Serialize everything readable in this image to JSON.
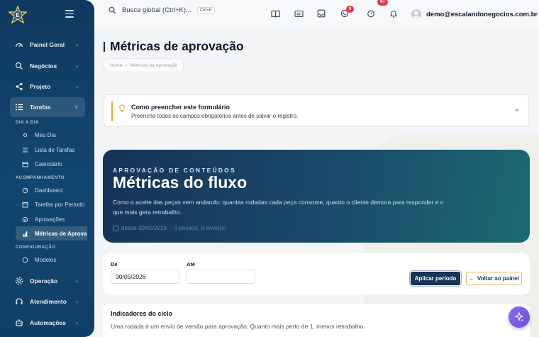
{
  "sidebar": {
    "logo_letter": "E",
    "nav": [
      {
        "label": "Painel Geral",
        "icon": "dashboard-gauge-icon"
      },
      {
        "label": "Negócios",
        "icon": "search-icon"
      },
      {
        "label": "Projeto",
        "icon": "share-nodes-icon"
      },
      {
        "label": "Tarefas",
        "icon": "tasks-list-icon"
      },
      {
        "label": "Operação",
        "icon": "gear-icon"
      },
      {
        "label": "Atendimento",
        "icon": "headset-icon"
      },
      {
        "label": "Automações",
        "icon": "robot-icon"
      }
    ],
    "sections": {
      "dia_a_dia": "DIA A DIA",
      "acompanhamento": "ACOMPANHAMENTO",
      "configuracao": "CONFIGURAÇÃO"
    },
    "sub_items": {
      "meu_dia": "Meu Dia",
      "lista_tarefas": "Lista de Tarefas",
      "calendario": "Calendário",
      "dashboard": "Dashboard",
      "tarefas_periodo": "Tarefas por Período",
      "aprovacoes": "Aprovações",
      "metricas": "Métricas de Aprova",
      "modelos": "Modelos"
    }
  },
  "topbar": {
    "search_placeholder": "Busca global (Ctrl+K)...",
    "shortcut": "Ctrl+K",
    "whatsapp_badge": "0",
    "timer_badge": "9+",
    "user_email": "demo@escalandonegocios.com.br"
  },
  "page": {
    "title": "Métricas de aprovação",
    "breadcrumb": [
      "Home",
      "Métricas de Aprovação"
    ]
  },
  "info_card": {
    "title": "Como preencher este formulário",
    "text": "Preencha todos os campos obrigatórios antes de salvar o registro."
  },
  "hero": {
    "eyebrow": "APROVAÇÃO DE CONTEÚDOS",
    "title": "Métricas do fluxo",
    "description": "Como o aceite das peças vem andando: quantas rodadas cada peça consome, quanto o cliente demora para responder e o que mais gera retrabalho.",
    "meta_since": "desde 30/05/2026",
    "meta_counts": "0 peça(s), 0 envio(s)"
  },
  "filters": {
    "from_label": "De",
    "from_value": "30/05/2026",
    "to_label": "Até",
    "to_value": "",
    "apply_label": "Aplicar período",
    "back_label": "Voltar ao painel"
  },
  "indicators": {
    "title": "Indicadores do ciclo",
    "text": "Uma rodada é um envio de versão para aprovação. Quanto mais perto de 1, menos retrabalho."
  }
}
